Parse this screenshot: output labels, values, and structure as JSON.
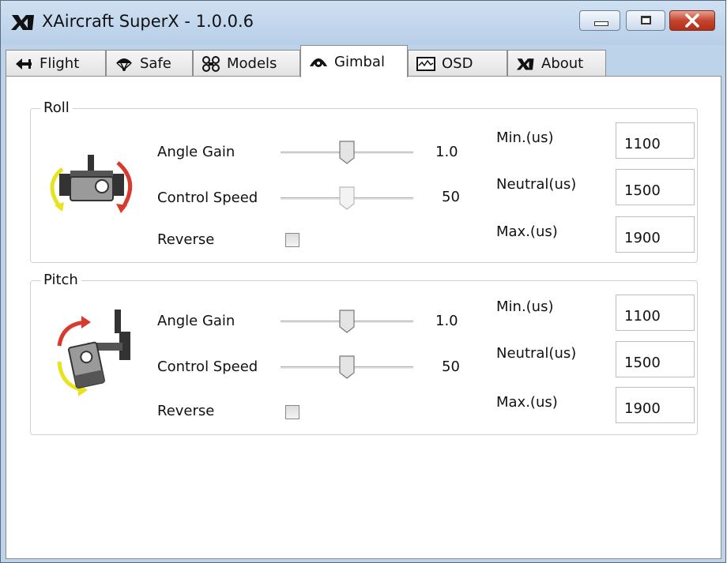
{
  "window": {
    "title": "XAircraft SuperX - 1.0.0.6"
  },
  "tabs": [
    {
      "label": "Flight",
      "icon": "plane-icon"
    },
    {
      "label": "Safe",
      "icon": "parachute-icon"
    },
    {
      "label": "Models",
      "icon": "quadcopter-icon"
    },
    {
      "label": "Gimbal",
      "icon": "gimbal-icon",
      "active": true
    },
    {
      "label": "OSD",
      "icon": "osd-monitor-icon"
    },
    {
      "label": "About",
      "icon": "xa-logo-icon"
    }
  ],
  "roll": {
    "legend": "Roll",
    "angle_gain": {
      "label": "Angle Gain",
      "value": "1.0",
      "level": 0.5
    },
    "control_speed": {
      "label": "Control Speed",
      "value": "50",
      "level": 0.5
    },
    "reverse": {
      "label": "Reverse",
      "checked": false
    },
    "min": {
      "label": "Min.(us)",
      "value": "1100"
    },
    "neutral": {
      "label": "Neutral(us)",
      "value": "1500"
    },
    "max": {
      "label": "Max.(us)",
      "value": "1900"
    }
  },
  "pitch": {
    "legend": "Pitch",
    "angle_gain": {
      "label": "Angle Gain",
      "value": "1.0",
      "level": 0.5
    },
    "control_speed": {
      "label": "Control Speed",
      "value": "50",
      "level": 0.5
    },
    "reverse": {
      "label": "Reverse",
      "checked": false
    },
    "min": {
      "label": "Min.(us)",
      "value": "1100"
    },
    "neutral": {
      "label": "Neutral(us)",
      "value": "1500"
    },
    "max": {
      "label": "Max.(us)",
      "value": "1900"
    }
  },
  "colors": {
    "accent_yellow": "#e8e31f",
    "accent_red": "#d83a2e",
    "titlebar": "#bcd3ea"
  }
}
